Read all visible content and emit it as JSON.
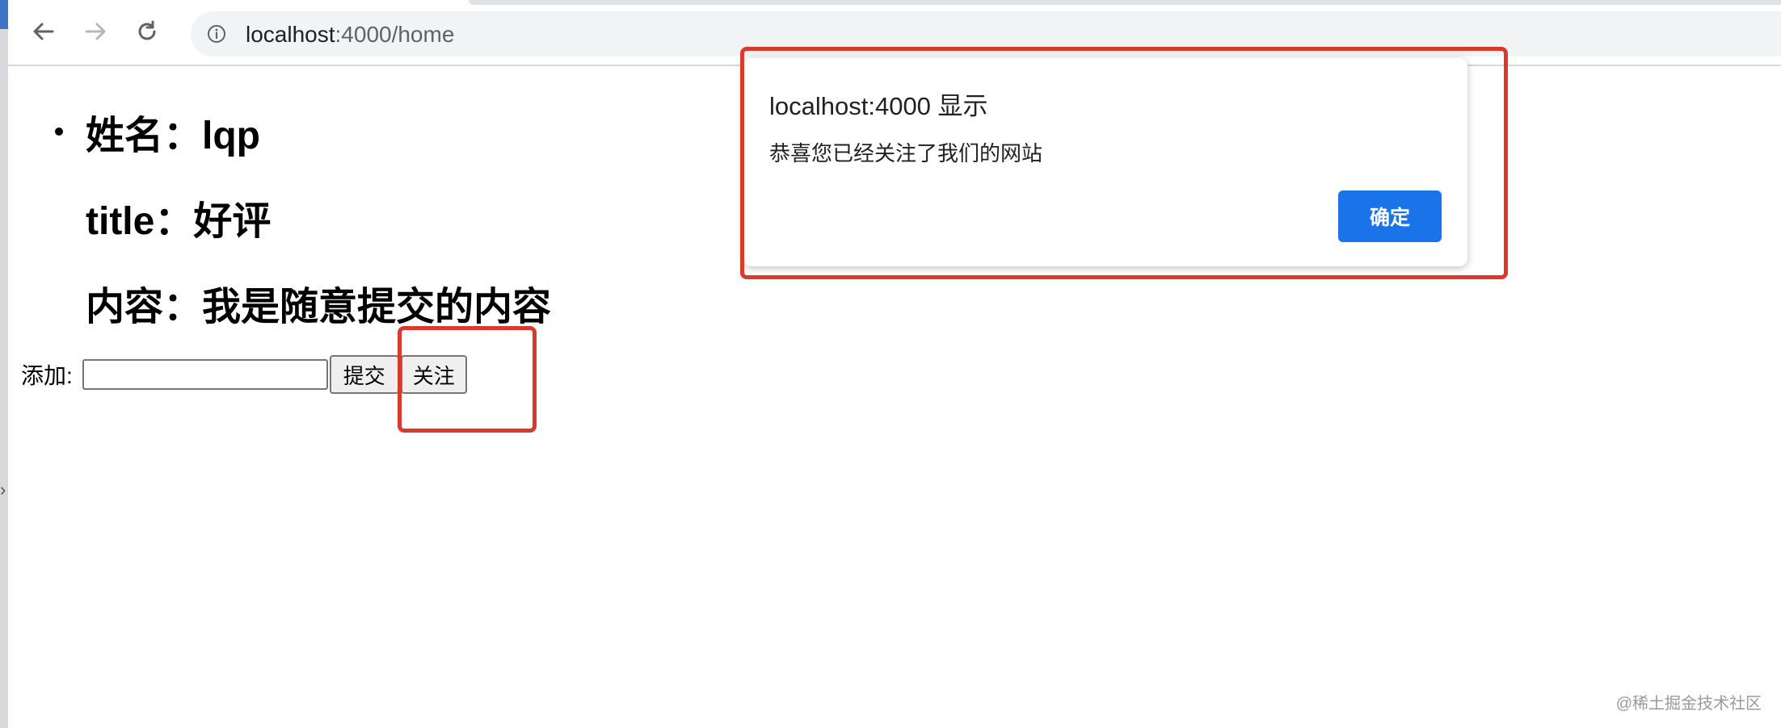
{
  "browser": {
    "url_host": "localhost",
    "url_rest": ":4000/home",
    "icons": {
      "back": "arrow-left-icon",
      "forward": "arrow-right-icon",
      "reload": "reload-icon",
      "site_info": "info-icon"
    }
  },
  "record": {
    "name_line": "姓名：lqp",
    "title_line": "title：好评",
    "content_line": "内容：我是随意提交的内容"
  },
  "form": {
    "add_label": "添加:",
    "input_value": "",
    "submit_label": "提交",
    "follow_label": "关注"
  },
  "alert": {
    "title": "localhost:4000 显示",
    "message": "恭喜您已经关注了我们的网站",
    "ok_label": "确定",
    "ok_color": "#1a73e8"
  },
  "annotation_color": "#d93a30",
  "watermark": "@稀土掘金技术社区"
}
